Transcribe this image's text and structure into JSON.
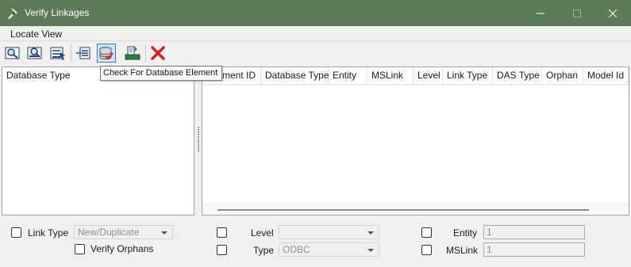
{
  "window": {
    "title": "Verify Linkages"
  },
  "menu": {
    "locate_view": "Locate View"
  },
  "toolbar": {
    "tooltip": "Check For Database Element",
    "buttons": [
      "zoom-element-icon",
      "zoom-fit-icon",
      "select-element-icon",
      "attach-linkage-icon",
      "check-database-element-icon",
      "export-icon",
      "delete-icon"
    ]
  },
  "left_pane": {
    "header": "Database Type"
  },
  "right_pane": {
    "headers": [
      "ment ID",
      "Database Type",
      "Entity",
      "MSLink",
      "Level",
      "Link Type",
      "DAS Type",
      "Orphan",
      "Model Id"
    ]
  },
  "filters": {
    "link_type": {
      "label": "Link Type",
      "value": "New/Duplicate"
    },
    "verify_orphans": {
      "label": "Verify Orphans"
    },
    "level": {
      "label": "Level",
      "value": ""
    },
    "type": {
      "label": "Type",
      "value": "ODBC"
    },
    "entity": {
      "label": "Entity",
      "value": "1"
    },
    "mslink": {
      "label": "MSLink",
      "value": "1"
    }
  },
  "colors": {
    "titlebar": "#5b7b55",
    "accent": "#3c7fc4",
    "delete": "#d62020"
  }
}
